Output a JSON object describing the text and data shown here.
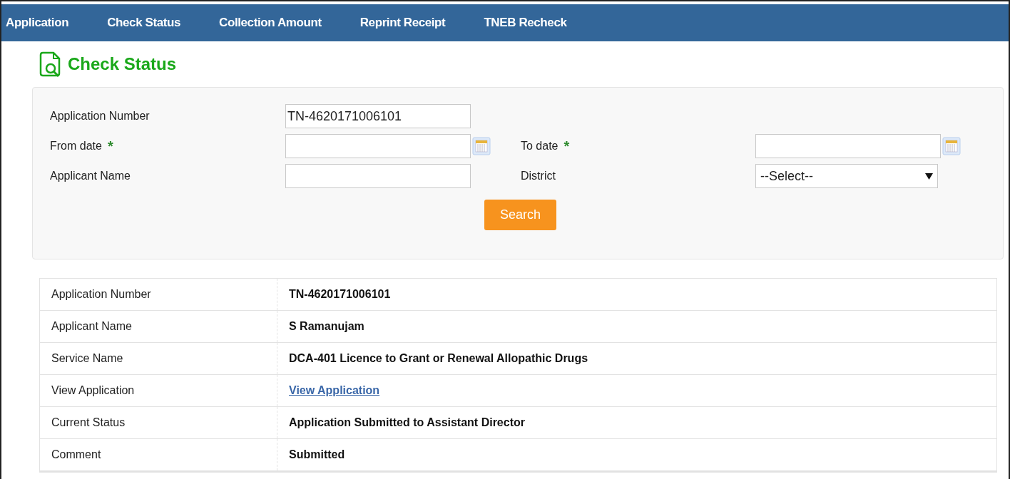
{
  "nav": {
    "items": [
      {
        "label": "Application",
        "selected": false
      },
      {
        "label": "Check Status",
        "selected": false
      },
      {
        "label": "Collection Amount",
        "selected": false
      },
      {
        "label": "Reprint Receipt",
        "selected": false
      },
      {
        "label": "TNEB Recheck",
        "selected": false
      }
    ]
  },
  "page_title": "Check Status",
  "search_form": {
    "fields": [
      {
        "label": "Application Number",
        "kind": "text",
        "value": "TN-4620171006101",
        "required": false
      },
      {
        "label": "From date",
        "kind": "date",
        "required": true
      },
      {
        "label": "To date",
        "kind": "date",
        "required": true
      },
      {
        "label": "Applicant Name",
        "kind": "text",
        "required": false
      },
      {
        "label": "District",
        "kind": "select",
        "value": "--Select--",
        "required": false
      }
    ],
    "required_mark": "*",
    "button": "Search"
  },
  "result_table": {
    "rows": [
      {
        "label": "Application Number",
        "kind": "text",
        "value": "TN-4620171006101"
      },
      {
        "label": "Applicant Name",
        "kind": "text",
        "value": "S Ramanujam"
      },
      {
        "label": "Service Name",
        "kind": "text",
        "value": "DCA-401 Licence to Grant or Renewal Allopathic Drugs"
      },
      {
        "label": "View Application",
        "kind": "link",
        "value": "View Application"
      },
      {
        "label": "Current Status",
        "kind": "text",
        "value": "Application Submitted to Assistant Director"
      },
      {
        "label": "Comment",
        "kind": "text",
        "value": "Submitted"
      }
    ]
  }
}
